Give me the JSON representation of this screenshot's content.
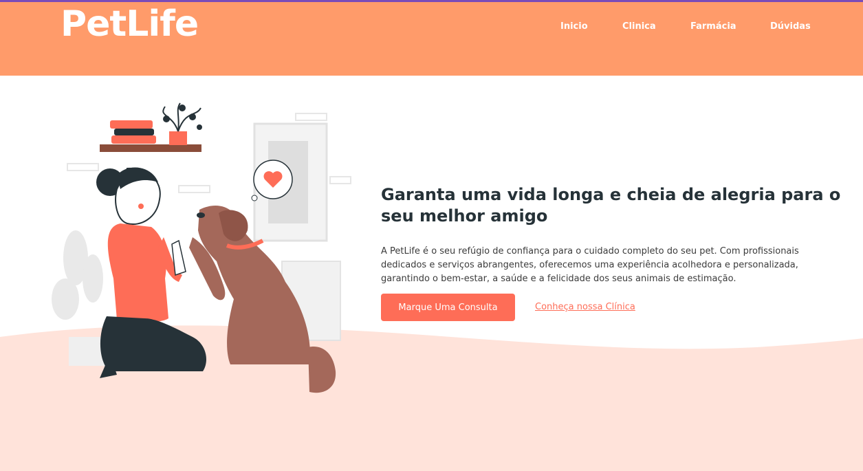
{
  "brand": {
    "logo_text": "PetLife"
  },
  "nav": {
    "items": [
      {
        "label": "Inicio"
      },
      {
        "label": "Clinica"
      },
      {
        "label": "Farmácia"
      },
      {
        "label": "Dúvidas"
      }
    ]
  },
  "hero": {
    "title": "Garanta uma vida longa e cheia de alegria para o seu melhor amigo",
    "description": "A PetLife é o seu refúgio de confiança para o cuidado completo do seu pet. Com profissionais dedicados e serviços abrangentes, oferecemos uma experiência acolhedora e personalizada, garantindo o bem-estar, a saúde e a felicidade dos seus animais de estimação.",
    "primary_button": "Marque Uma Consulta",
    "secondary_link": "Conheça nossa Clínica"
  },
  "colors": {
    "header_bg": "#ff9b6a",
    "accent": "#fe6d57",
    "wave_bg": "#ffe3da",
    "text_dark": "#263238"
  }
}
